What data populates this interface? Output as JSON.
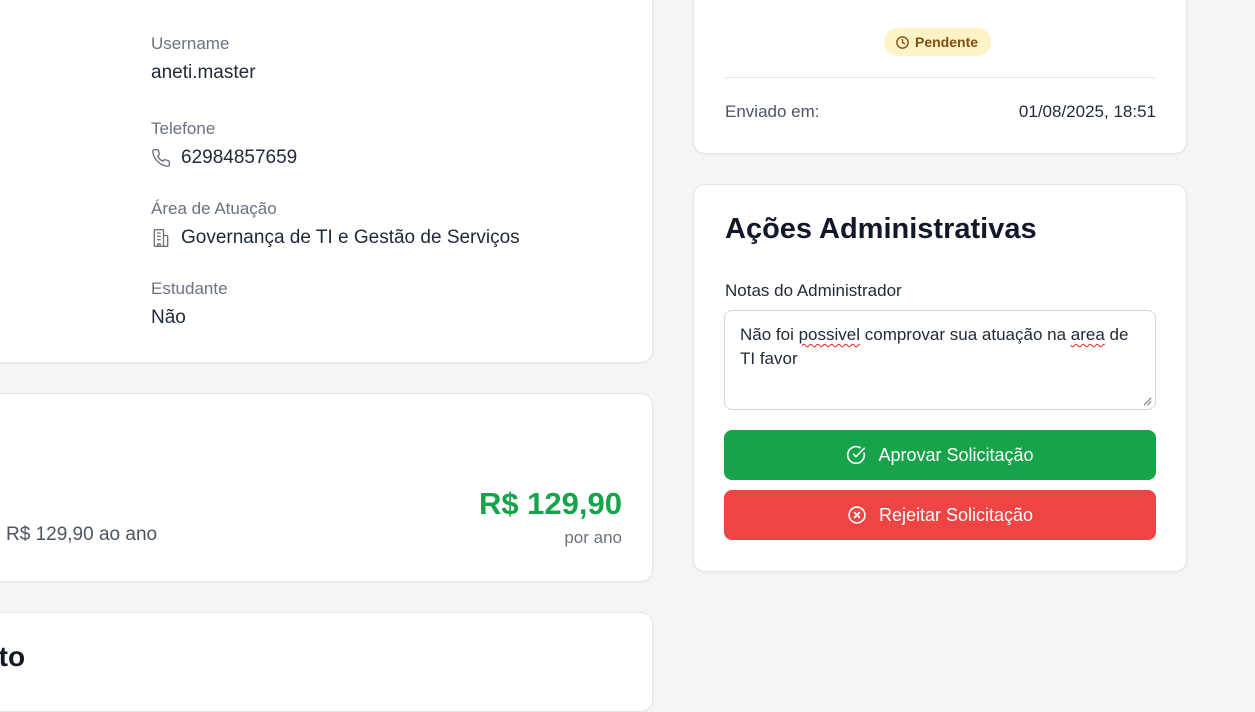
{
  "profile": {
    "username_label": "Username",
    "username_value": "aneti.master",
    "phone_label": "Telefone",
    "phone_value": "62984857659",
    "area_label": "Área de Atuação",
    "area_value": "Governança de TI e Gestão de Serviços",
    "student_label": "Estudante",
    "student_value": "Não"
  },
  "plan": {
    "description": "R$ 129,90 ao ano",
    "price": "R$ 129,90",
    "period": "por ano"
  },
  "payment": {
    "title_fragment": "ento"
  },
  "status": {
    "badge": "Pendente",
    "sent_label": "Enviado em:",
    "sent_value": "01/08/2025, 18:51"
  },
  "admin": {
    "title": "Ações Administrativas",
    "notes_label": "Notas do Administrador",
    "notes_parts": [
      "Não foi ",
      "possivel",
      " comprovar sua atuação na ",
      "area",
      " de TI favor"
    ],
    "approve_label": "Aprovar Solicitação",
    "reject_label": "Rejeitar Solicitação"
  },
  "colors": {
    "success": "#16a34a",
    "danger": "#ef4444",
    "pending_bg": "#fef3c7",
    "pending_text": "#854d0e"
  }
}
